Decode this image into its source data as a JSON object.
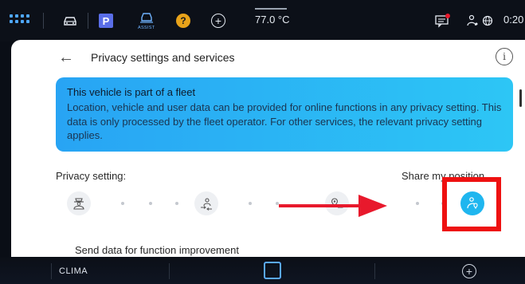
{
  "statusbar": {
    "temperature": "77.0 °C",
    "time": "0:20",
    "assist_label": "ASSIST",
    "p_badge": "P",
    "help_badge": "?",
    "add_symbol": "+"
  },
  "header": {
    "title": "Privacy settings and services",
    "back_symbol": "←",
    "info_symbol": "i"
  },
  "fleet_notice": {
    "title": "This vehicle is part of a fleet",
    "body": "Location, vehicle and user data can be provided for online functions in any privacy setting. This data is only processed by the fleet operator. For other services, the relevant privacy setting applies."
  },
  "privacy": {
    "label": "Privacy setting:",
    "selected_label": "Share my position",
    "levels": [
      "maximum-privacy-icon",
      "share-usage-icon",
      "share-location-icon",
      "share-my-position-icon"
    ],
    "selected_index": 3
  },
  "send_data_label": "Send data for function improvement",
  "bottombar": {
    "clima": "CLIMA",
    "add_symbol": "+"
  },
  "colors": {
    "accent": "#1fb6ef",
    "highlight": "#ee1111",
    "arrow": "#e8192c"
  }
}
